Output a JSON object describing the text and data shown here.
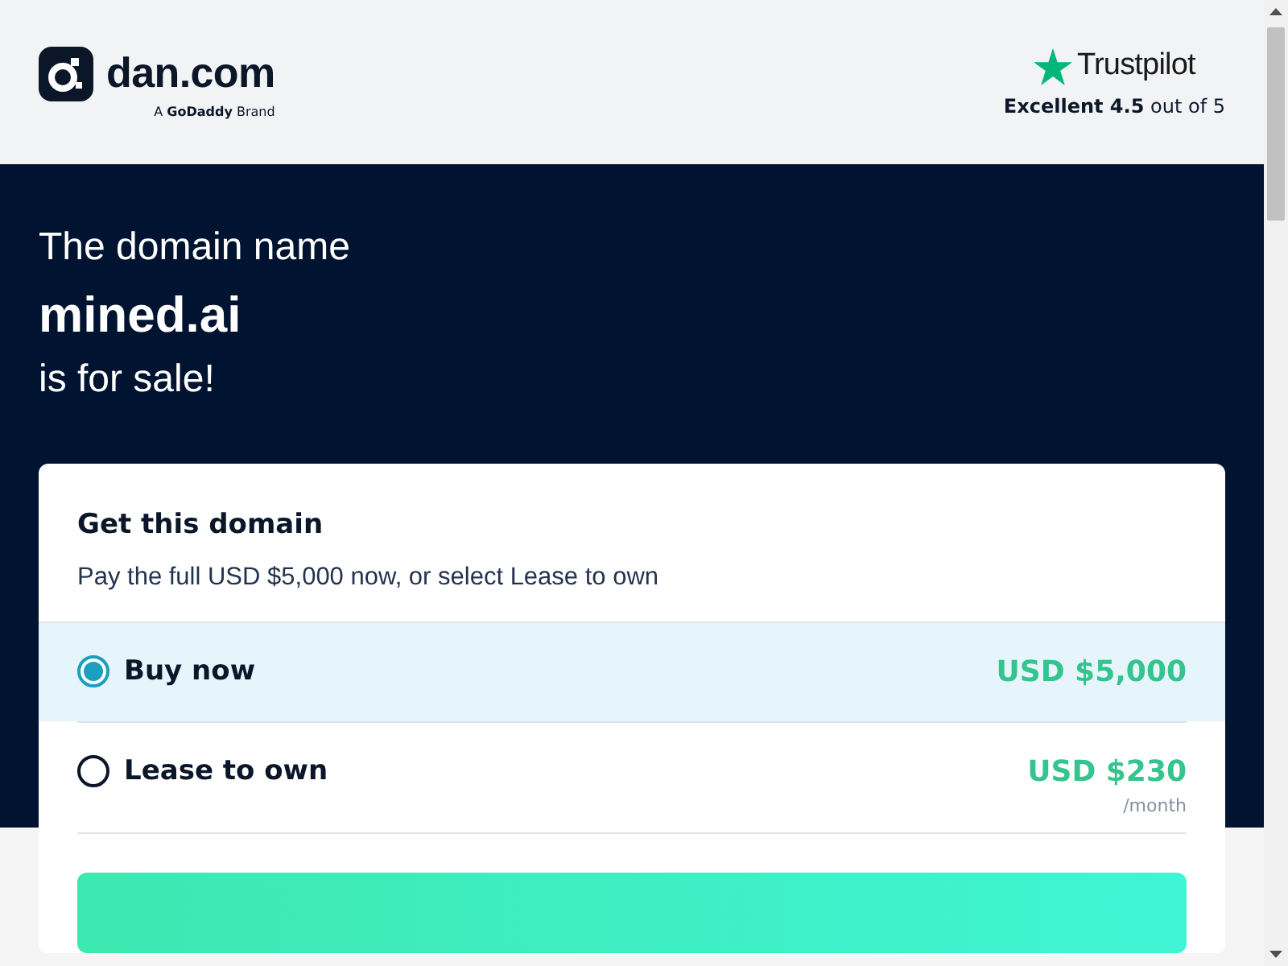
{
  "header": {
    "logo": {
      "name": "dan.com",
      "tagline": "A **GoDaddy** Brand"
    },
    "rating": {
      "brand": "Trustpilot",
      "summary": "**Excellent 4.5** out of 5"
    }
  },
  "hero": {
    "intro": "The domain name",
    "domain": "mined.ai",
    "outro": "is for sale!"
  },
  "card": {
    "title": "Get this domain",
    "subtitle": "Pay the full USD $5,000 now, or select Lease to own",
    "options": [
      {
        "label": "Buy now",
        "price": "USD $5,000",
        "selected": true
      },
      {
        "label": "Lease to own",
        "price": "USD $230",
        "period": "/month",
        "selected": false
      }
    ]
  }
}
